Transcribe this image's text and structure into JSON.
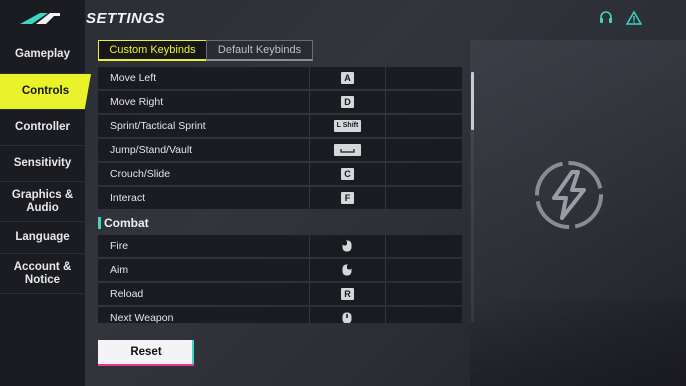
{
  "header": {
    "title": "SETTINGS"
  },
  "icons": {
    "logo": "brand-logo",
    "support": "headset-icon",
    "report": "warning-icon",
    "emblem": "bolt-emblem-icon"
  },
  "sidebar": {
    "items": [
      {
        "label": "Gameplay"
      },
      {
        "label": "Controls",
        "active": true
      },
      {
        "label": "Controller"
      },
      {
        "label": "Sensitivity"
      },
      {
        "label": "Graphics &\nAudio"
      },
      {
        "label": "Language"
      },
      {
        "label": "Account &\nNotice"
      }
    ]
  },
  "tabs": [
    {
      "label": "Custom Keybinds",
      "active": true
    },
    {
      "label": "Default Keybinds",
      "active": false
    }
  ],
  "keybinds": {
    "movement": [
      {
        "action": "Move Left",
        "key": "A"
      },
      {
        "action": "Move Right",
        "key": "D"
      },
      {
        "action": "Sprint/Tactical Sprint",
        "key": "L Shift"
      },
      {
        "action": "Jump/Stand/Vault",
        "key": "space-key"
      },
      {
        "action": "Crouch/Slide",
        "key": "C"
      },
      {
        "action": "Interact",
        "key": "F"
      }
    ],
    "combat_title": "Combat",
    "combat": [
      {
        "action": "Fire",
        "key": "left-mouse-icon"
      },
      {
        "action": "Aim",
        "key": "right-mouse-icon"
      },
      {
        "action": "Reload",
        "key": "R"
      },
      {
        "action": "Next Weapon",
        "key": "mouse-wheel-icon"
      }
    ]
  },
  "footer": {
    "reset_label": "Reset"
  },
  "colors": {
    "accent": "#e9f22a",
    "teal": "#3fd6c2",
    "pink": "#e23a8e"
  }
}
